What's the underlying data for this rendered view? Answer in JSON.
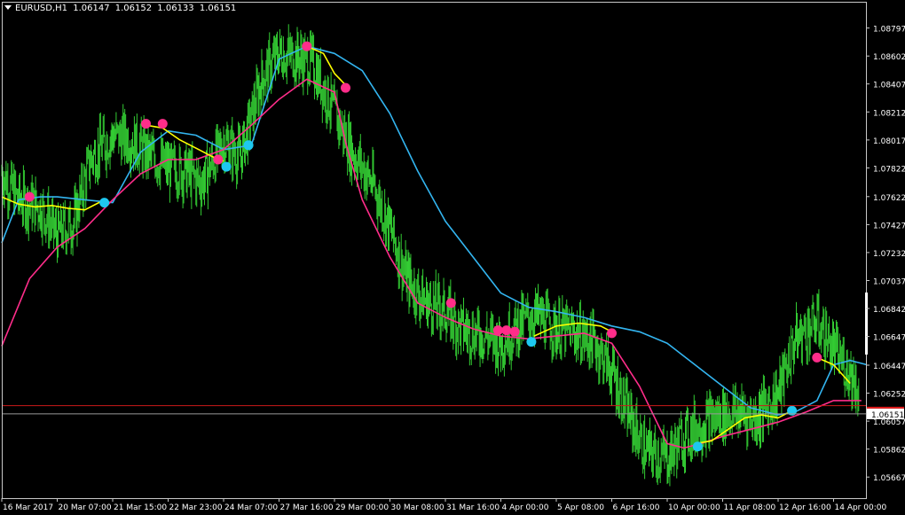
{
  "header": {
    "symbol": "EURUSD,H1",
    "open": "1.06147",
    "high": "1.06152",
    "low": "1.06133",
    "close": "1.06151"
  },
  "chart_data": {
    "type": "line",
    "title": "EURUSD,H1",
    "ylim": [
      1.0552,
      1.0898
    ],
    "y_ticks": [
      "1.08797",
      "1.08602",
      "1.08407",
      "1.08212",
      "1.08017",
      "1.07822",
      "1.07622",
      "1.07427",
      "1.07232",
      "1.07037",
      "1.06842",
      "1.06647",
      "1.06447",
      "1.06252",
      "1.06057",
      "1.05862",
      "1.05667"
    ],
    "x_ticks": [
      "16 Mar 2017",
      "20 Mar 07:00",
      "21 Mar 15:00",
      "22 Mar 23:00",
      "24 Mar 07:00",
      "27 Mar 16:00",
      "29 Mar 00:00",
      "30 Mar 08:00",
      "31 Mar 16:00",
      "4 Apr 00:00",
      "5 Apr 08:00",
      "6 Apr 16:00",
      "10 Apr 00:00",
      "11 Apr 08:00",
      "12 Apr 16:00",
      "14 Apr 00:00"
    ],
    "current_price": "1.06151",
    "current_price_value": 1.06151,
    "price_line_value": 1.06165,
    "price": {
      "name": "",
      "color": "#33cc33",
      "x": [
        0,
        0.3,
        0.7,
        1,
        1.3,
        1.6,
        2,
        2.3,
        2.7,
        3,
        3.3,
        3.6,
        4,
        4.3,
        4.7,
        5,
        5.3,
        5.6,
        6,
        6.3,
        6.7,
        7,
        7.3,
        7.6,
        8,
        8.3,
        8.7,
        9,
        9.3,
        9.6,
        10,
        10.3,
        10.7,
        11,
        11.3,
        11.6,
        12,
        12.3,
        12.7,
        13,
        13.3,
        13.6,
        14,
        14.3,
        14.7,
        15,
        15.3,
        15.6
      ],
      "values": [
        1.0778,
        1.076,
        1.0755,
        1.0735,
        1.0745,
        1.0788,
        1.0805,
        1.0802,
        1.079,
        1.0782,
        1.078,
        1.0772,
        1.08,
        1.079,
        1.0845,
        1.0862,
        1.086,
        1.0855,
        1.082,
        1.0795,
        1.077,
        1.074,
        1.0705,
        1.069,
        1.0682,
        1.067,
        1.0665,
        1.066,
        1.0672,
        1.068,
        1.067,
        1.0668,
        1.066,
        1.064,
        1.061,
        1.0585,
        1.058,
        1.0595,
        1.0605,
        1.061,
        1.0612,
        1.0608,
        1.0625,
        1.0662,
        1.0675,
        1.0655,
        1.064,
        1.0615
      ]
    },
    "series": [
      {
        "name": "",
        "color": "#33b5f0",
        "x": [
          0,
          0.3,
          0.7,
          1,
          1.5,
          2,
          2.5,
          3,
          3.5,
          4,
          4.5,
          5,
          5.5,
          6,
          6.5,
          7,
          7.5,
          8,
          8.5,
          9,
          9.5,
          10,
          10.5,
          11,
          11.5,
          12,
          12.5,
          13,
          13.5,
          14,
          14.3,
          14.7,
          15,
          15.3,
          15.6
        ],
        "values": [
          1.073,
          1.076,
          1.0762,
          1.0762,
          1.076,
          1.0758,
          1.0793,
          1.0808,
          1.0805,
          1.0795,
          1.0798,
          1.0858,
          1.0867,
          1.0862,
          1.085,
          1.082,
          1.078,
          1.0745,
          1.072,
          1.0695,
          1.0685,
          1.0682,
          1.0678,
          1.0672,
          1.0668,
          1.066,
          1.0645,
          1.063,
          1.0615,
          1.061,
          1.0612,
          1.062,
          1.0645,
          1.0648,
          1.0645
        ]
      },
      {
        "name": "",
        "color": "#ff2d8a",
        "x": [
          0,
          0.5,
          1,
          1.5,
          2,
          2.5,
          3,
          3.5,
          4,
          4.5,
          5,
          5.5,
          6,
          6.2,
          6.5,
          7,
          7.5,
          8,
          8.5,
          9,
          9.5,
          10,
          10.5,
          11,
          11.5,
          12,
          12.3,
          12.6,
          13,
          13.5,
          14,
          14.5,
          15,
          15.5
        ],
        "values": [
          1.0658,
          1.0705,
          1.0727,
          1.074,
          1.076,
          1.0778,
          1.0788,
          1.0788,
          1.0795,
          1.0812,
          1.083,
          1.0844,
          1.0835,
          1.08,
          1.076,
          1.072,
          1.0688,
          1.0678,
          1.067,
          1.0665,
          1.0663,
          1.0665,
          1.0667,
          1.066,
          1.063,
          1.059,
          1.0587,
          1.059,
          1.0595,
          1.06,
          1.0605,
          1.0612,
          1.062,
          1.062
        ]
      },
      {
        "name": "",
        "color": "#ffff00",
        "segments": [
          {
            "x": [
              0,
              0.3,
              0.6,
              0.9,
              1.2,
              1.5,
              1.8
            ],
            "values": [
              1.0762,
              1.0757,
              1.0755,
              1.0756,
              1.0754,
              1.0753,
              1.0759
            ]
          },
          {
            "x": [
              2.6,
              2.9,
              3.2,
              3.5,
              3.8,
              4.0
            ],
            "values": [
              1.0812,
              1.081,
              1.0802,
              1.0796,
              1.079,
              1.0787
            ]
          },
          {
            "x": [
              5.5,
              5.8,
              6.0,
              6.2
            ],
            "values": [
              1.0867,
              1.0862,
              1.0848,
              1.084
            ]
          },
          {
            "x": [
              9.6,
              10.0,
              10.4,
              10.8,
              11.0
            ],
            "values": [
              1.0665,
              1.0672,
              1.0674,
              1.0672,
              1.0668
            ]
          },
          {
            "x": [
              12.5,
              12.8,
              13.1,
              13.4,
              13.7,
              14.0,
              14.2
            ],
            "values": [
              1.059,
              1.0592,
              1.06,
              1.0608,
              1.061,
              1.0608,
              1.0612
            ]
          },
          {
            "x": [
              14.7,
              15.0,
              15.3
            ],
            "values": [
              1.065,
              1.0645,
              1.0632
            ]
          }
        ]
      }
    ],
    "markers": [
      {
        "type": "sell",
        "color": "#ff2d8a",
        "x": 0.5,
        "value": 1.0762
      },
      {
        "type": "buy",
        "color": "#1ec8f0",
        "x": 1.85,
        "value": 1.0758
      },
      {
        "type": "sell",
        "color": "#ff2d8a",
        "x": 2.6,
        "value": 1.0813
      },
      {
        "type": "sell",
        "color": "#ff2d8a",
        "x": 2.9,
        "value": 1.0813
      },
      {
        "type": "sell",
        "color": "#ff2d8a",
        "x": 3.9,
        "value": 1.0788
      },
      {
        "type": "buy",
        "color": "#1ec8f0",
        "x": 4.05,
        "value": 1.0783
      },
      {
        "type": "buy",
        "color": "#1ec8f0",
        "x": 4.45,
        "value": 1.0798
      },
      {
        "type": "sell",
        "color": "#ff2d8a",
        "x": 5.5,
        "value": 1.0867
      },
      {
        "type": "sell",
        "color": "#ff2d8a",
        "x": 6.2,
        "value": 1.0838
      },
      {
        "type": "sell",
        "color": "#ff2d8a",
        "x": 8.1,
        "value": 1.0688
      },
      {
        "type": "sell",
        "color": "#ff2d8a",
        "x": 8.95,
        "value": 1.0669
      },
      {
        "type": "sell",
        "color": "#ff2d8a",
        "x": 9.1,
        "value": 1.0669
      },
      {
        "type": "sell",
        "color": "#ff2d8a",
        "x": 9.25,
        "value": 1.0668
      },
      {
        "type": "buy",
        "color": "#1ec8f0",
        "x": 9.55,
        "value": 1.0661
      },
      {
        "type": "sell",
        "color": "#ff2d8a",
        "x": 11.0,
        "value": 1.0667
      },
      {
        "type": "buy",
        "color": "#1ec8f0",
        "x": 12.55,
        "value": 1.0588
      },
      {
        "type": "buy",
        "color": "#1ec8f0",
        "x": 14.25,
        "value": 1.0613
      },
      {
        "type": "sell",
        "color": "#ff2d8a",
        "x": 14.7,
        "value": 1.065
      }
    ]
  }
}
